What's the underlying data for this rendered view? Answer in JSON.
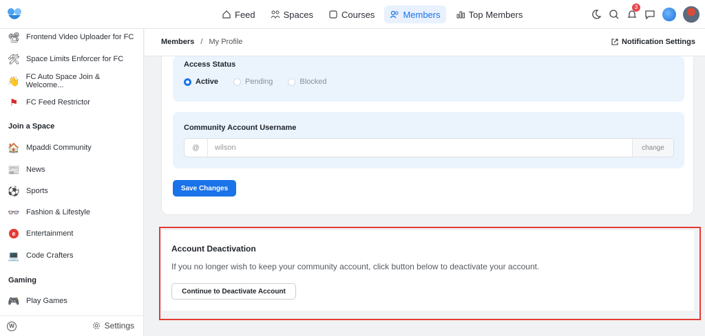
{
  "nav": {
    "items": [
      {
        "label": "Feed",
        "icon": "home-icon"
      },
      {
        "label": "Spaces",
        "icon": "users-icon"
      },
      {
        "label": "Courses",
        "icon": "book-icon"
      },
      {
        "label": "Members",
        "icon": "members-icon",
        "active": true
      },
      {
        "label": "Top Members",
        "icon": "chart-icon"
      }
    ],
    "notification_count": "3",
    "accent": "#1a73e8"
  },
  "sidebar": {
    "plugins": [
      {
        "label": "Frontend Video Uploader for FC",
        "icon": "camera-icon"
      },
      {
        "label": "Space Limits Enforcer for FC",
        "icon": "tools-icon"
      },
      {
        "label": "FC Auto Space Join & Welcome...",
        "icon": "wave-icon"
      },
      {
        "label": "FC Feed Restrictor",
        "icon": "flag-icon"
      }
    ],
    "join_heading": "Join a Space",
    "spaces": [
      {
        "label": "Mpaddi Community",
        "icon": "house-icon"
      },
      {
        "label": "News",
        "icon": "news-icon"
      },
      {
        "label": "Sports",
        "icon": "soccer-icon"
      },
      {
        "label": "Fashion & Lifestyle",
        "icon": "glasses-icon"
      },
      {
        "label": "Entertainment",
        "icon": "e-icon"
      },
      {
        "label": "Code Crafters",
        "icon": "laptop-icon"
      }
    ],
    "gaming_heading": "Gaming",
    "gaming": [
      {
        "label": "Play Games",
        "icon": "gamepad-icon"
      }
    ],
    "footer": {
      "settings_label": "Settings"
    }
  },
  "header": {
    "breadcrumb_root": "Members",
    "breadcrumb_sep": "/",
    "breadcrumb_current": "My Profile",
    "notification_settings": "Notification Settings"
  },
  "profile": {
    "access_status_label": "Access Status",
    "status_options": [
      {
        "label": "Active",
        "checked": true
      },
      {
        "label": "Pending",
        "checked": false
      },
      {
        "label": "Blocked",
        "checked": false
      }
    ],
    "username_label": "Community Account Username",
    "username_prefix": "@",
    "username_value": "wilson",
    "username_change": "change",
    "save_label": "Save Changes"
  },
  "deactivation": {
    "title": "Account Deactivation",
    "description": "If you no longer wish to keep your community account, click button below to deactivate your account.",
    "button_label": "Continue to Deactivate Account",
    "highlight_color": "#e53935"
  }
}
